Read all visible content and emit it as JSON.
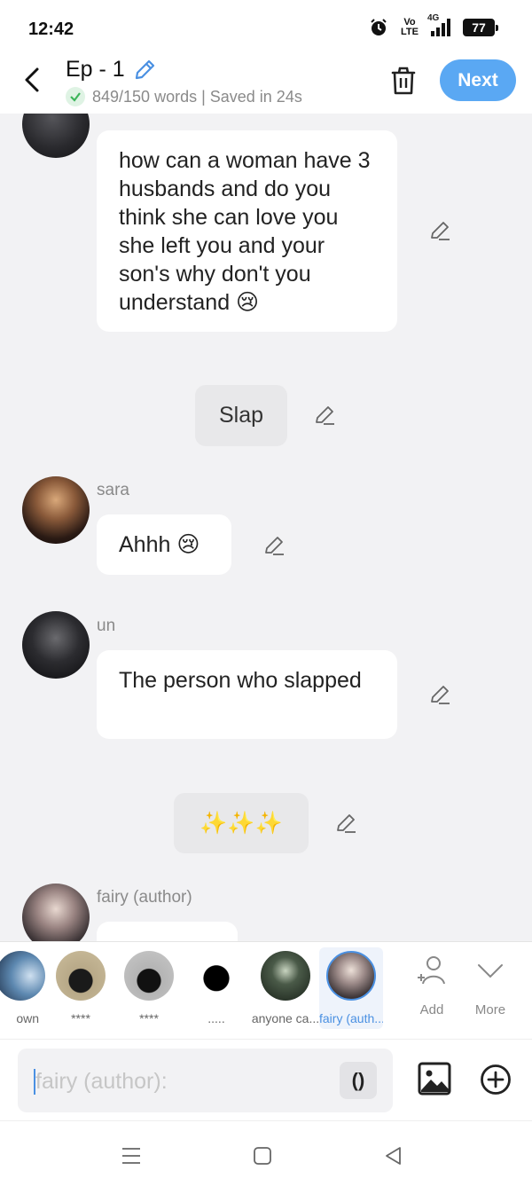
{
  "status_bar": {
    "time": "12:42",
    "volte_top": "Vo",
    "volte_bottom": "LTE",
    "network": "4G",
    "battery": "77"
  },
  "header": {
    "title": "Ep - 1",
    "subtitle": "849/150 words | Saved in 24s",
    "next_label": "Next"
  },
  "messages": [
    {
      "type": "bubble",
      "text": "how can a woman have 3 husbands and do you think she can love you she left you and your son's why don't you understand 😢"
    },
    {
      "type": "action",
      "text": "Slap"
    },
    {
      "type": "bubble",
      "speaker": "sara",
      "text": "Ahhh 😢"
    },
    {
      "type": "bubble",
      "speaker": "un",
      "text": "The person who slapped"
    },
    {
      "type": "action",
      "text": "✨✨✨"
    },
    {
      "type": "bubble",
      "speaker": "fairy (author)",
      "text": ""
    }
  ],
  "characters": [
    {
      "name": "own"
    },
    {
      "name": "****"
    },
    {
      "name": "****"
    },
    {
      "name": "....."
    },
    {
      "name": "anyone ca..."
    },
    {
      "name": "fairy (auth..."
    }
  ],
  "picker_actions": {
    "add": "Add",
    "more": "More"
  },
  "input": {
    "placeholder": "fairy (author):",
    "paren_label": "()"
  },
  "colors": {
    "accent": "#5aa8f3",
    "background": "#f2f2f4"
  }
}
